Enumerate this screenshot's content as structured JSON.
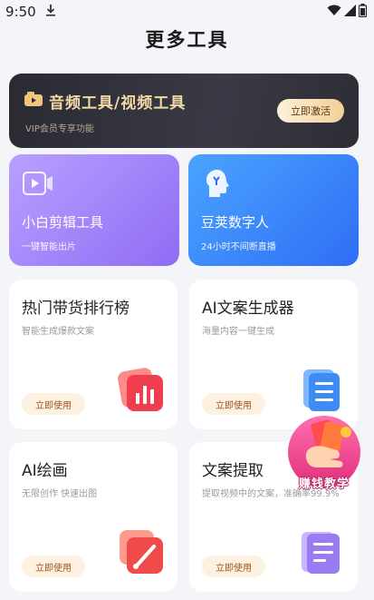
{
  "status_bar": {
    "time": "9:50"
  },
  "page": {
    "title": "更多工具"
  },
  "banner": {
    "title": "音频工具/视频工具",
    "subtitle": "VIP会员专享功能",
    "button_label": "立即激活"
  },
  "feature_cards": [
    {
      "title": "小白剪辑工具",
      "subtitle": "一键智能出片",
      "icon": "video-play-icon"
    },
    {
      "title": "豆荚数字人",
      "subtitle": "24小时不间断直播",
      "icon": "digital-human-icon"
    }
  ],
  "tools": [
    {
      "title": "热门带货排行榜",
      "subtitle": "智能生成爆款文案",
      "button_label": "立即使用",
      "icon": "bar-chart-icon"
    },
    {
      "title": "AI文案生成器",
      "subtitle": "海量内容一键生成",
      "button_label": "立即使用",
      "icon": "document-lines-icon"
    },
    {
      "title": "AI绘画",
      "subtitle": "无限创作 快速出图",
      "button_label": "立即使用",
      "icon": "paint-brush-icon"
    },
    {
      "title": "文案提取",
      "subtitle": "提取视频中的文案，准确率99.9%",
      "button_label": "立即使用",
      "icon": "text-document-icon"
    }
  ],
  "floating_badge": {
    "label": "赚钱教学"
  },
  "colors": {
    "banner_accent": "#f3d9a6",
    "purple_card": "#8f6cf5",
    "blue_card": "#2f6df5",
    "use_button_text": "#a0521d",
    "badge_pink": "#e6367f"
  }
}
